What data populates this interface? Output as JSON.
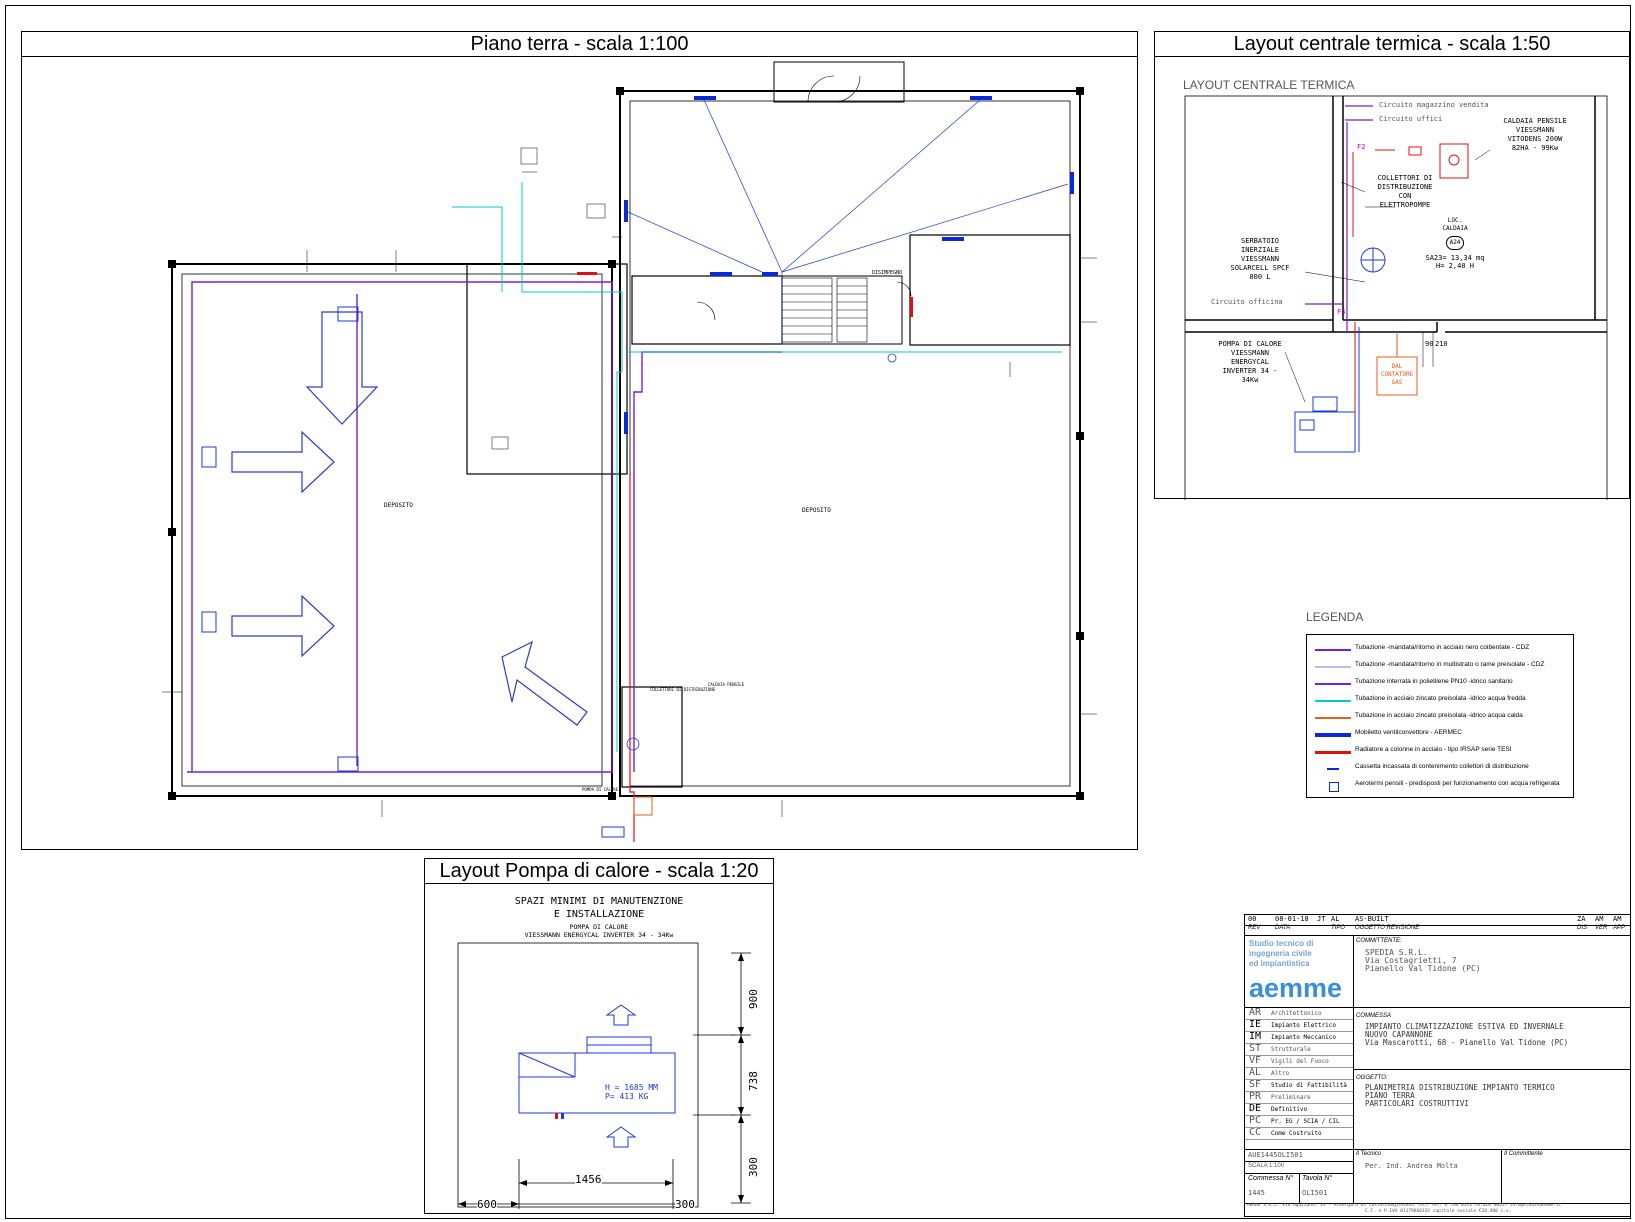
{
  "panels": {
    "piano_terra": {
      "title": "Piano  terra - scala 1:100"
    },
    "centrale": {
      "title": "Layout centrale termica - scala 1:50",
      "subtitle": "LAYOUT CENTRALE TERMICA"
    },
    "pompa": {
      "title": "Layout Pompa di calore - scala 1:20"
    }
  },
  "plan_labels": {
    "deposito_left": "DEPOSITO",
    "deposito_right": "DEPOSITO",
    "disimpegno": "DISIMPEGNO",
    "aermec": "AERMEC",
    "caldaia_pensile": "CALDAIA PENSILE",
    "collettori": "COLLETTORI DI DISTRIBUZIONE",
    "pompa_calore": "POMPA DI CALORE"
  },
  "centrale": {
    "circuito_magazzino": "Circuito magazzino vendita",
    "circuito_uffici": "Circuito uffici",
    "circuito_officina": "Circuito officina",
    "caldaia": [
      "CALDAIA PENSILE",
      "VIESSMANN",
      "VITODENS 200W",
      "82HA - 99Kw"
    ],
    "collettori": [
      "COLLETTORI DI",
      "DISTRIBUZIONE",
      "CON",
      "ELETTROPOMPE"
    ],
    "loc": [
      "LOC.",
      "CALDAIA"
    ],
    "room_id": "A24",
    "room_dims": [
      "SA23= 13,34 mq",
      "H= 2,40 H"
    ],
    "serbatoio": [
      "SERBATOIO",
      "INERZIALE",
      "VIESSMANN",
      "SOLARCELL SPCF",
      "800 L"
    ],
    "pompa": [
      "POMPA DI CALORE",
      "VIESSMANN",
      "ENERGYCAL",
      "INVERTER 34 -",
      "34Kw"
    ],
    "contatore": [
      "DAL",
      "CONTATORE",
      "GAS"
    ],
    "f2": "F2",
    "f4": "F4",
    "dim90": "90",
    "dim210": "210"
  },
  "pompa_layout": {
    "heading": [
      "SPAZI MINIMI DI MANUTENZIONE",
      "E INSTALLAZIONE"
    ],
    "sub": [
      "POMPA DI CALORE",
      "VIESSMANN ENERGYCAL INVERTER 34 - 34Kw"
    ],
    "unit_text": [
      "H = 1685 MM",
      "P= 413 KG"
    ],
    "dims": {
      "top": "900",
      "mid": "738",
      "bottom": "300",
      "width": "1456",
      "left": "600",
      "right": "300"
    }
  },
  "legenda": {
    "title": "LEGENDA",
    "items": [
      {
        "text": "Tubazione -mandata/ritorno in acciaio nero coibentate - CDZ",
        "color": "#7a1fd0"
      },
      {
        "text": "Tubazione -mandata/ritorno in multistrato o rame preisolate - CDZ",
        "color": "#c9b3ea"
      },
      {
        "text": "Tubazione interrata in polietilene PN10 -idrico sanitario",
        "color": "#7a1fd0"
      },
      {
        "text": "Tubazione in acciaio zincato preisolata -idrico acqua fredda",
        "color": "#00c8d8"
      },
      {
        "text": "Tubazione in acciaio zincato preisolata -idrico acqua calda",
        "color": "#e06020"
      },
      {
        "text": "Mobiletto ventilconvettore - AERMEC",
        "color": "#0a2ad8"
      },
      {
        "text": "Radiatore a colonne in acciaio - tipo IRSAP serie TESI",
        "color": "#e01010"
      },
      {
        "text": "Cassetta incassata di contenimento collettori di distribuzione",
        "color": "#0a2ad8"
      },
      {
        "text": "Aerotermi pensili - predisposti per funzionamento con acqua refrigerata",
        "color": "#0a2ad8"
      }
    ]
  },
  "title_block": {
    "rev_row": [
      "00",
      "08-01-18",
      "JT",
      "AL",
      "AS-BUILT",
      "ZA",
      "AM",
      "AM"
    ],
    "rev_head": [
      "REV",
      "DATA",
      "TIPO",
      "OGGETTO REVISIONE",
      "DIS",
      "VER",
      "APP"
    ],
    "studio": [
      "Studio tecnico di",
      "ingegneria civile",
      "ed impiantistica"
    ],
    "logo": "aemme",
    "committente_label": "COMMITTENTE:",
    "committente": [
      "SPEDIA S.R.L.",
      "Via Costagrietti, 7",
      "Pianello Val Tidone (PC)"
    ],
    "disciplines": [
      [
        "AR",
        "Architettonico"
      ],
      [
        "IE",
        "Impianto Elettrico"
      ],
      [
        "IM",
        "Impianto Meccanico"
      ],
      [
        "ST",
        "Strutturale"
      ],
      [
        "VF",
        "Vigili del Fuoco"
      ],
      [
        "AL",
        "Altro"
      ],
      [
        "SF",
        "Studio di Fattibilità"
      ],
      [
        "PR",
        "Preliminare"
      ],
      [
        "DE",
        "Definitivo"
      ],
      [
        "PC",
        "Pr. EG / SCIA / CIL"
      ],
      [
        "CC",
        "Come Costruito"
      ]
    ],
    "commessa_label": "COMMESSA",
    "commessa": [
      "IMPIANTO CLIMATIZZAZIONE ESTIVA ED INVERNALE",
      "NUOVO CAPANNONE",
      "Via Mascarotti, 68 - Pianello Val Tidone (PC)"
    ],
    "oggetto_label": "OGGETTO:",
    "oggetto": [
      "PLANIMETRIA DISTRIBUZIONE IMPIANTO TERMICO",
      "PIANO TERRA",
      "PARTICOLARI COSTRUTTIVI"
    ],
    "code": "AUE1445OLI501",
    "scala": "SCALA 1:100",
    "tecnico_label": "Il Tecnico",
    "tecnico": "Per. Ind. Andrea Molta",
    "committente_sign": "Il Committente",
    "commessa_n_label": "Commessa N°",
    "commessa_n": "1445",
    "tavola_label": "Tavola N°",
    "tavola": "OLI501",
    "footer": "AEMME S.R.L. Via Agazzano, 24 - Rivergaro di Castelsangiovanni (PC) Tel. e fax 0523 76.620 email info@studioaemme.it",
    "footer2": "C.F. e P.IVA 01179860332 capitale sociale €20.400 i.v."
  }
}
